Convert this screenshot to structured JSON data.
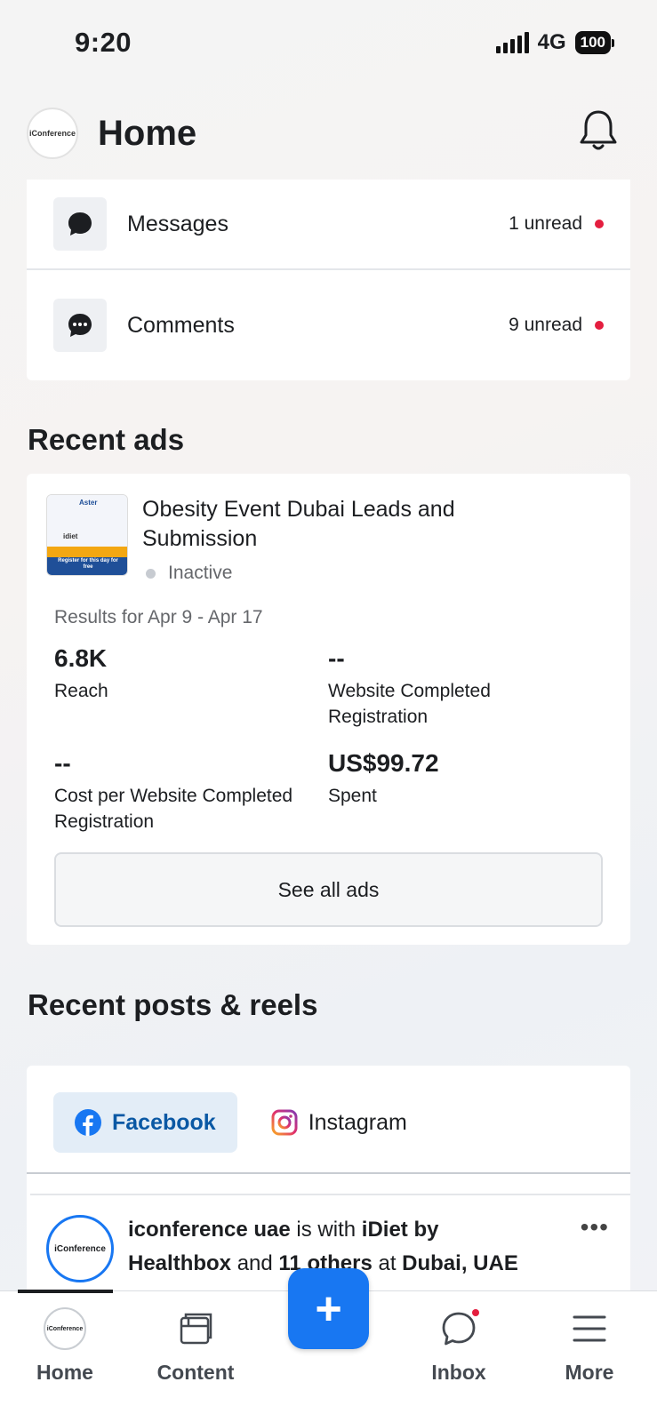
{
  "status_bar": {
    "time": "9:20",
    "network": "4G",
    "battery": "100"
  },
  "header": {
    "title": "Home",
    "logo_text": "iConference"
  },
  "inbox": {
    "items": [
      {
        "label": "Messages",
        "count": "1 unread",
        "icon": "message-bubble-icon"
      },
      {
        "label": "Comments",
        "count": "9 unread",
        "icon": "comment-bubble-icon"
      }
    ]
  },
  "recent_ads": {
    "title": "Recent ads",
    "ad": {
      "name": "Obesity Event  Dubai Leads and Submission",
      "status": "Inactive",
      "thumbnail_texts": [
        "Aster",
        "idiet",
        "Register for this day for free"
      ],
      "results_label": "Results for Apr 9 - Apr 17",
      "metrics": [
        {
          "value": "6.8K",
          "label": "Reach"
        },
        {
          "value": "--",
          "label": "Website Completed Registration"
        },
        {
          "value": "--",
          "label": "Cost per Website Completed Registration"
        },
        {
          "value": "US$99.72",
          "label": "Spent"
        }
      ]
    },
    "see_all_label": "See all ads"
  },
  "recent_posts": {
    "title": "Recent posts & reels",
    "tabs": [
      {
        "label": "Facebook",
        "icon": "facebook-icon"
      },
      {
        "label": "Instagram",
        "icon": "instagram-icon"
      }
    ],
    "post": {
      "author": "iconference uae",
      "with_text": "is with",
      "partner": "iDiet by Healthbox",
      "and_text": "and",
      "others": "11 others",
      "at_text": "at",
      "location": "Dubai, UAE",
      "avatar_text": "iConference"
    }
  },
  "bottom_nav": {
    "items": [
      {
        "label": "Home"
      },
      {
        "label": "Content"
      },
      {
        "label": "Inbox"
      },
      {
        "label": "More"
      }
    ],
    "fab_label": "+"
  },
  "colors": {
    "accent": "#1877f2",
    "unread_dot": "#e41e3f",
    "active_tab_bg": "#e3edf7"
  }
}
